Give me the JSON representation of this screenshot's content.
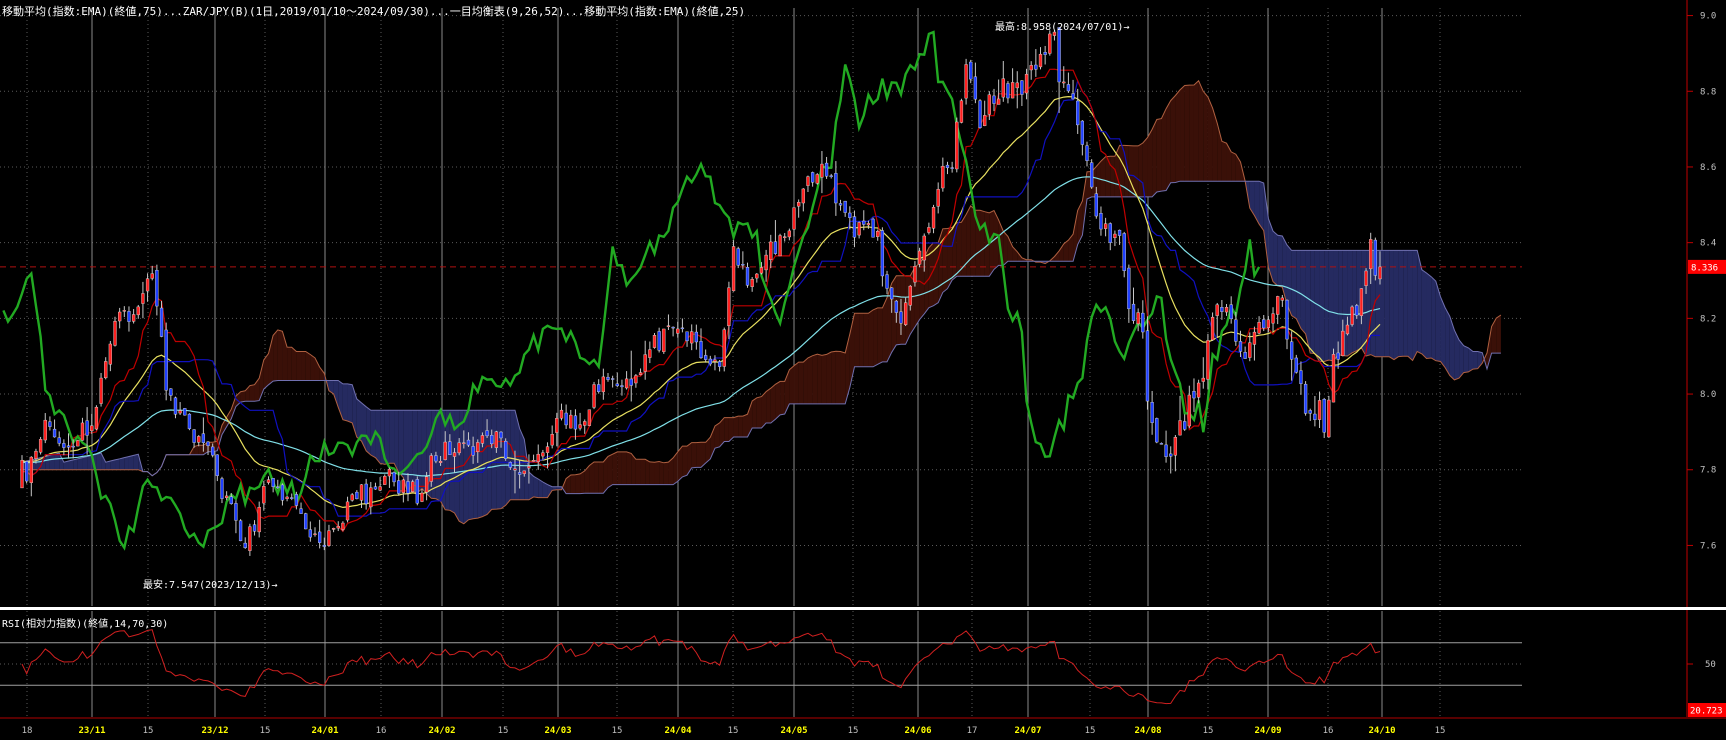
{
  "header": {
    "main_indicators": "移動平均(指数:EMA)(終値,75)...ZAR/JPY(B)(1日,2019/01/10～2024/09/30)...一目均衡表(9,26,52)...移動平均(指数:EMA)(終値,25)",
    "rsi_title": "RSI(相対力指数)(終値,14,70,30)"
  },
  "annotations": {
    "high_label": "最高:8.958(2024/07/01)→",
    "low_label": "最安:7.547(2023/12/13)→"
  },
  "colors": {
    "up_candle": "#ff2020",
    "down_candle": "#2040ff",
    "chikou": "#22aa22",
    "tenkan": "#c00000",
    "kijun": "#1010c0",
    "ema25": "#e8e060",
    "ema75": "#80e0e8",
    "kumo_bull": "#3a1008",
    "kumo_bear": "#252a60",
    "rsi_line": "#d02020",
    "grid_v": "#8a8a8a",
    "grid_h": "#5a5a5a",
    "price_axis": "#c00000",
    "current_price_bg": "#ff0000"
  },
  "chart_data": [
    {
      "type": "candlestick",
      "name": "ZAR/JPY(B)",
      "ylim": [
        7.44,
        9.02
      ],
      "yticks": [
        "9.0",
        "8.8",
        "8.6",
        "8.4",
        "8.2",
        "8.0",
        "7.8",
        "7.6"
      ],
      "ytick_values": [
        9.0,
        8.8,
        8.6,
        8.4,
        8.2,
        8.0,
        7.8,
        7.6
      ],
      "current_price": 8.336,
      "current_price_label": "8.336",
      "xtick_labels": [
        "18",
        "23/11",
        "15",
        "23/12",
        "15",
        "24/01",
        "16",
        "24/02",
        "15",
        "24/03",
        "15",
        "24/04",
        "15",
        "24/05",
        "15",
        "24/06",
        "17",
        "24/07",
        "15",
        "24/08",
        "15",
        "24/09",
        "16",
        "24/10",
        "15"
      ],
      "month_tick_labels": [
        "23/11",
        "23/12",
        "24/01",
        "24/02",
        "24/03",
        "24/04",
        "24/05",
        "24/06",
        "24/07",
        "24/08",
        "24/09",
        "24/10"
      ],
      "close_keypoints": [
        [
          0,
          7.75
        ],
        [
          5,
          7.92
        ],
        [
          10,
          7.85
        ],
        [
          15,
          7.9
        ],
        [
          20,
          8.2
        ],
        [
          25,
          8.22
        ],
        [
          28,
          8.32
        ],
        [
          31,
          8.02
        ],
        [
          35,
          7.92
        ],
        [
          40,
          7.85
        ],
        [
          45,
          7.7
        ],
        [
          48,
          7.56
        ],
        [
          52,
          7.74
        ],
        [
          58,
          7.72
        ],
        [
          63,
          7.62
        ],
        [
          67,
          7.63
        ],
        [
          72,
          7.74
        ],
        [
          78,
          7.78
        ],
        [
          85,
          7.75
        ],
        [
          90,
          7.84
        ],
        [
          95,
          7.87
        ],
        [
          100,
          7.9
        ],
        [
          106,
          7.8
        ],
        [
          110,
          7.82
        ],
        [
          116,
          7.95
        ],
        [
          120,
          7.92
        ],
        [
          126,
          8.06
        ],
        [
          130,
          8.01
        ],
        [
          135,
          8.12
        ],
        [
          140,
          8.2
        ],
        [
          146,
          8.1
        ],
        [
          150,
          8.06
        ],
        [
          153,
          8.4
        ],
        [
          156,
          8.28
        ],
        [
          162,
          8.4
        ],
        [
          168,
          8.55
        ],
        [
          172,
          8.6
        ],
        [
          175,
          8.52
        ],
        [
          180,
          8.45
        ],
        [
          184,
          8.4
        ],
        [
          186,
          8.25
        ],
        [
          189,
          8.2
        ],
        [
          193,
          8.38
        ],
        [
          197,
          8.55
        ],
        [
          200,
          8.62
        ],
        [
          203,
          8.88
        ],
        [
          206,
          8.7
        ],
        [
          210,
          8.8
        ],
        [
          214,
          8.82
        ],
        [
          218,
          8.88
        ],
        [
          221,
          8.95
        ],
        [
          224,
          8.8
        ],
        [
          227,
          8.7
        ],
        [
          231,
          8.5
        ],
        [
          235,
          8.4
        ],
        [
          240,
          8.2
        ],
        [
          244,
          7.85
        ],
        [
          247,
          7.8
        ],
        [
          250,
          7.95
        ],
        [
          253,
          8.0
        ],
        [
          257,
          8.27
        ],
        [
          262,
          8.12
        ],
        [
          266,
          8.16
        ],
        [
          270,
          8.25
        ],
        [
          274,
          8.06
        ],
        [
          277,
          7.95
        ],
        [
          280,
          7.92
        ],
        [
          283,
          8.14
        ],
        [
          287,
          8.22
        ],
        [
          290,
          8.4
        ],
        [
          292,
          8.336
        ]
      ],
      "volatility_keypoints": [
        [
          0,
          0.035
        ],
        [
          150,
          0.035
        ],
        [
          200,
          0.04
        ],
        [
          240,
          0.06
        ],
        [
          260,
          0.045
        ],
        [
          292,
          0.04
        ]
      ]
    },
    {
      "type": "line",
      "name": "RSI",
      "ylim": [
        0,
        100
      ],
      "yticks": [
        "50"
      ],
      "ytick_values": [
        50
      ],
      "reference_levels": [
        70,
        30
      ],
      "current_value_label": "20.723"
    }
  ]
}
